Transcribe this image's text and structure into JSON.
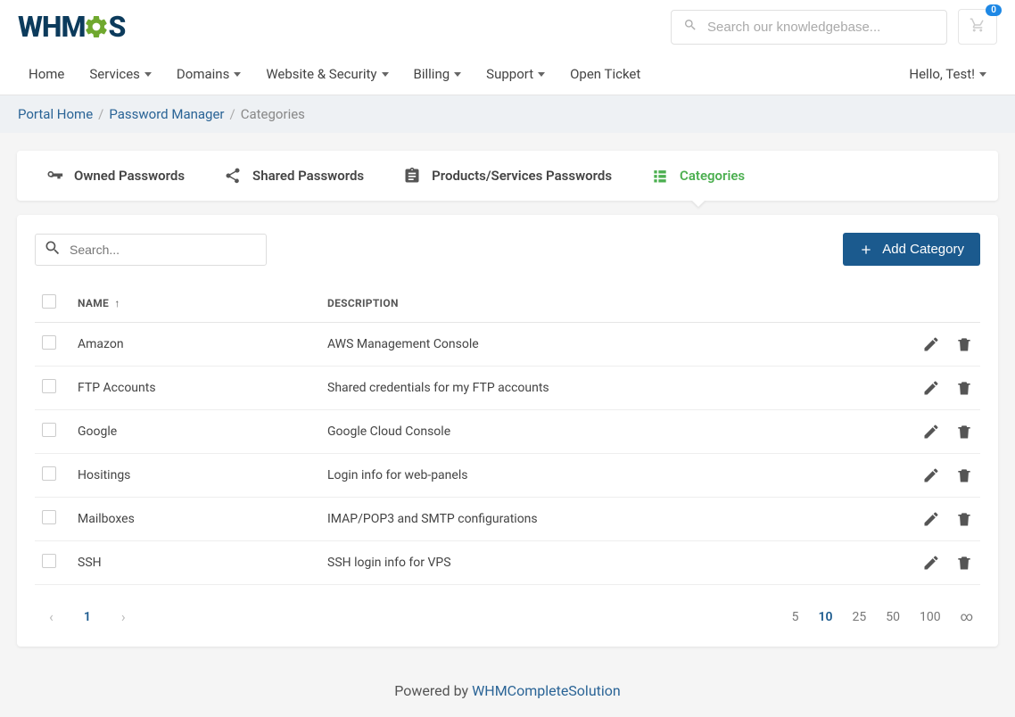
{
  "brand": {
    "text_a": "WHM",
    "text_b": "S"
  },
  "search": {
    "placeholder": "Search our knowledgebase..."
  },
  "cart": {
    "badge": "0"
  },
  "nav": {
    "items": [
      {
        "label": "Home",
        "dropdown": false
      },
      {
        "label": "Services",
        "dropdown": true
      },
      {
        "label": "Domains",
        "dropdown": true
      },
      {
        "label": "Website & Security",
        "dropdown": true
      },
      {
        "label": "Billing",
        "dropdown": true
      },
      {
        "label": "Support",
        "dropdown": true
      },
      {
        "label": "Open Ticket",
        "dropdown": false
      }
    ],
    "greeting": "Hello, Test!"
  },
  "breadcrumb": {
    "items": [
      {
        "label": "Portal Home",
        "link": true
      },
      {
        "label": "Password Manager",
        "link": true
      },
      {
        "label": "Categories",
        "link": false
      }
    ]
  },
  "tabs": [
    {
      "label": "Owned Passwords",
      "icon": "key",
      "active": false
    },
    {
      "label": "Shared Passwords",
      "icon": "share",
      "active": false
    },
    {
      "label": "Products/Services Passwords",
      "icon": "clipboard",
      "active": false
    },
    {
      "label": "Categories",
      "icon": "list",
      "active": true
    }
  ],
  "table": {
    "search_placeholder": "Search...",
    "add_button": "Add Category",
    "columns": {
      "name": "Name",
      "description": "Description"
    },
    "rows": [
      {
        "name": "Amazon",
        "description": "AWS Management Console"
      },
      {
        "name": "FTP Accounts",
        "description": "Shared credentials for my FTP accounts"
      },
      {
        "name": "Google",
        "description": "Google Cloud Console"
      },
      {
        "name": "Hositings",
        "description": "Login info for web-panels"
      },
      {
        "name": "Mailboxes",
        "description": "IMAP/POP3 and SMTP configurations"
      },
      {
        "name": "SSH",
        "description": "SSH login info for VPS"
      }
    ]
  },
  "pagination": {
    "current": "1",
    "sizes": [
      "5",
      "10",
      "25",
      "50",
      "100",
      "∞"
    ],
    "active_size": "10"
  },
  "footer": {
    "prefix": "Powered by ",
    "link": "WHMCompleteSolution"
  }
}
